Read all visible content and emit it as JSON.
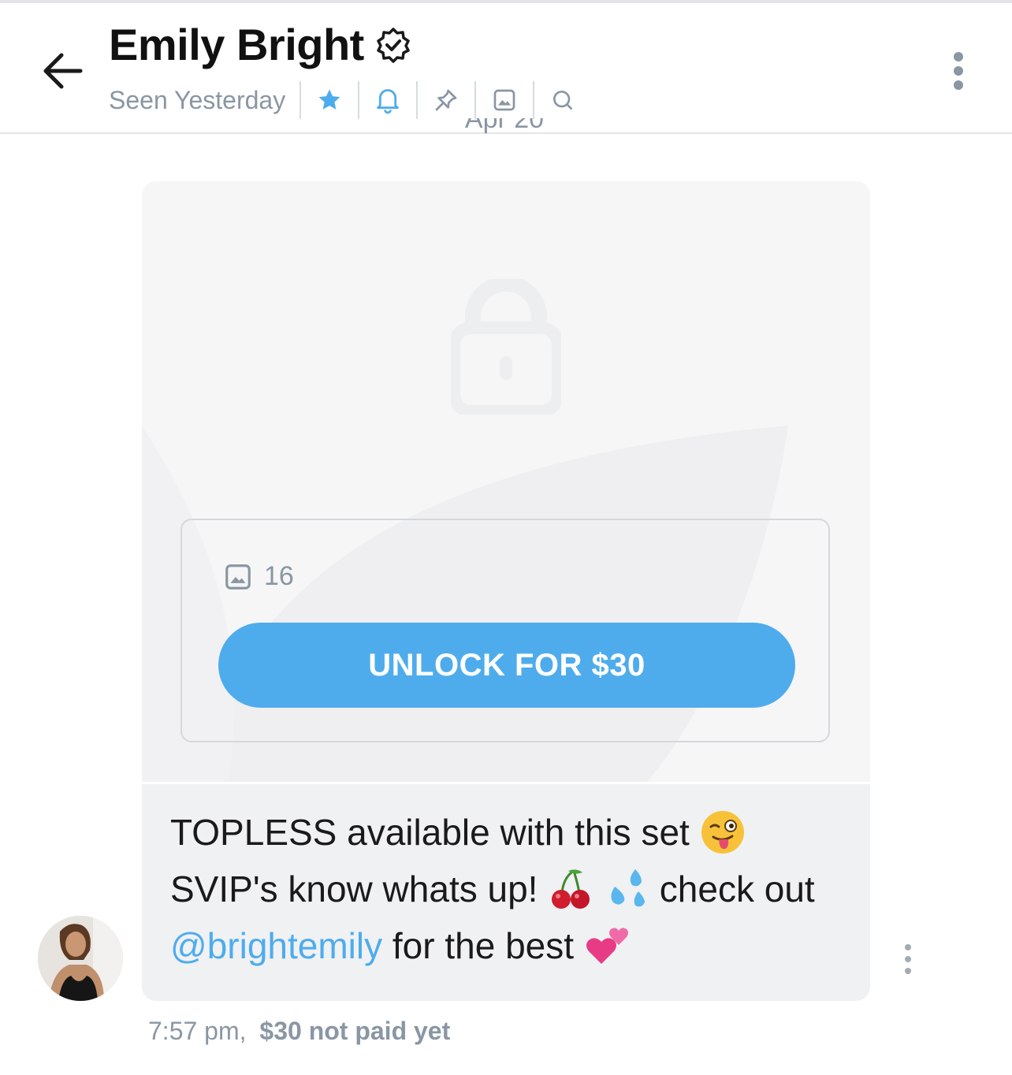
{
  "header": {
    "title": "Emily Bright",
    "status": "Seen Yesterday"
  },
  "chat": {
    "date_label": "Apr 20",
    "media_count": "16",
    "unlock_label": "UNLOCK FOR $30",
    "message": {
      "line1": "TOPLESS available with this set",
      "line2_a": "SVIP's know whats up!",
      "line2_b": "check out",
      "mention": "@brightemily",
      "line3": "for the best"
    },
    "time": "7:57 pm,",
    "payment_status": "$30 not paid yet"
  },
  "icons": {
    "back": "arrow-left-icon",
    "verified": "verified-badge-icon",
    "star": "star-icon",
    "bell": "bell-icon",
    "pin": "pin-icon",
    "gallery": "image-icon",
    "search": "search-icon",
    "more": "more-vertical-icon",
    "lock": "lock-icon",
    "emojis": [
      "winking-face-with-tongue",
      "cherries",
      "sweat-droplets",
      "two-hearts"
    ]
  },
  "colors": {
    "accent": "#4eaced",
    "muted": "#8a96a3",
    "bubble": "#f0f1f3"
  }
}
